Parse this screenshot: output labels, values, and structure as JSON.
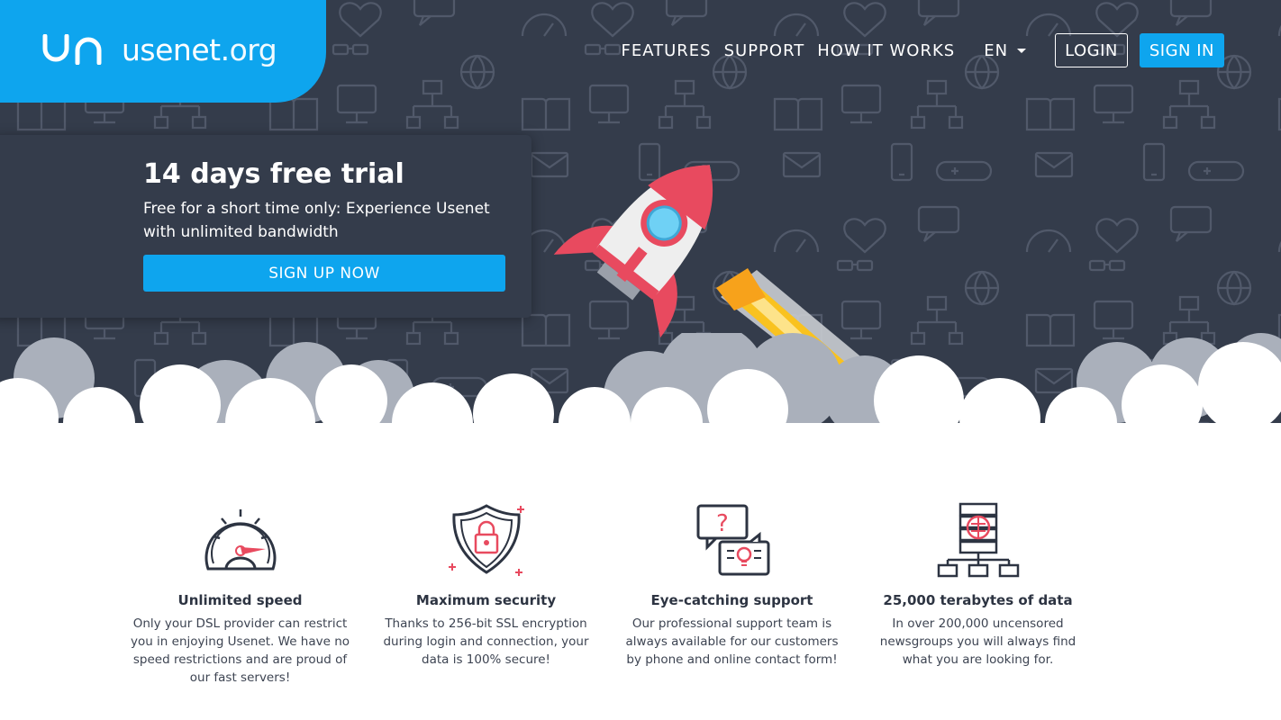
{
  "brand": {
    "mark": "un",
    "name": "usenet",
    "tld": ".org"
  },
  "nav": {
    "links": [
      "FEATURES",
      "SUPPORT",
      "HOW IT WORKS"
    ],
    "language": "EN",
    "login_label": "LOGIN",
    "signin_label": "SIGN IN"
  },
  "promo": {
    "title": "14 days free trial",
    "text": "Free for a short time only: Experience Usenet with unlimited bandwidth",
    "button_label": "SIGN UP NOW"
  },
  "colors": {
    "primary": "#0ea5ee",
    "dark": "#343c4b",
    "accent_red": "#e84a5f",
    "flame_yellow": "#f9c21f"
  },
  "features": [
    {
      "icon": "speedometer-icon",
      "title": "Unlimited speed",
      "text": "Only your DSL provider can restrict you in enjoying Usenet. We have no speed restrictions and are proud of our fast servers!"
    },
    {
      "icon": "shield-lock-icon",
      "title": "Maximum security",
      "text": "Thanks to 256-bit SSL encryption during login and connection, your data is 100% secure!"
    },
    {
      "icon": "support-chat-icon",
      "title": "Eye-catching support",
      "text": "Our professional support team is always available for our customers by phone and online contact form!"
    },
    {
      "icon": "server-network-icon",
      "title": "25,000 terabytes of data",
      "text": "In over 200,000 uncensored newsgroups you will always find what you are looking for."
    }
  ]
}
